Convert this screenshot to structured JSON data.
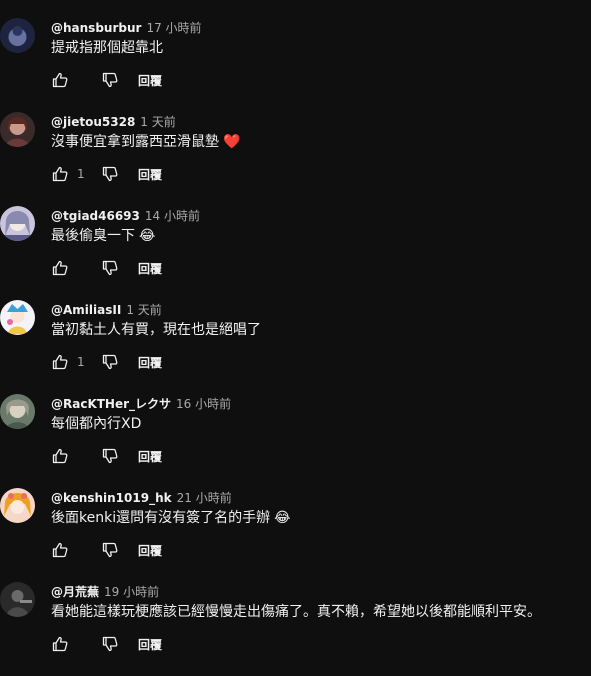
{
  "comments": [
    {
      "author": "@hansburbur",
      "time": "17 小時前",
      "text": "提戒指那個超靠北",
      "likes": "",
      "reply_label": "回覆",
      "avatar_colors": [
        "#1e2440",
        "#7a86b8"
      ]
    },
    {
      "author": "@jietou5328",
      "time": "1 天前",
      "text": "沒事便宜拿到露西亞滑鼠墊",
      "text_suffix": "❤️",
      "likes": "1",
      "reply_label": "回覆",
      "avatar_colors": [
        "#3a2a2a",
        "#c89a8a"
      ]
    },
    {
      "author": "@tgiad46693",
      "time": "14 小時前",
      "text": "最後偷臭一下",
      "text_suffix": "😂",
      "likes": "",
      "reply_label": "回覆",
      "avatar_colors": [
        "#c9c4dc",
        "#5a5a8a"
      ]
    },
    {
      "author": "@AmiliasII",
      "time": "1 天前",
      "text": "當初黏土人有買，現在也是絕唱了",
      "likes": "1",
      "reply_label": "回覆",
      "avatar_colors": [
        "#f4f4f8",
        "#3aa0d8"
      ]
    },
    {
      "author": "@RacKTHer_レクサ",
      "time": "16 小時前",
      "text": "每個都內行XD",
      "likes": "",
      "reply_label": "回覆",
      "avatar_colors": [
        "#6a7a6a",
        "#d8d0c0"
      ]
    },
    {
      "author": "@kenshin1019_hk",
      "time": "21 小時前",
      "text": "後面kenki還問有沒有簽了名的手辦",
      "text_suffix": "😂",
      "likes": "",
      "reply_label": "回覆",
      "avatar_colors": [
        "#f6d6c6",
        "#e86a6a"
      ]
    },
    {
      "author": "@月荒蕪",
      "time": "19 小時前",
      "text": "看她能這樣玩梗應該已經慢慢走出傷痛了。真不賴，希望她以後都能順利平安。",
      "likes": "",
      "reply_label": "回覆",
      "avatar_colors": [
        "#2a2a2a",
        "#6a6a6a"
      ]
    }
  ]
}
